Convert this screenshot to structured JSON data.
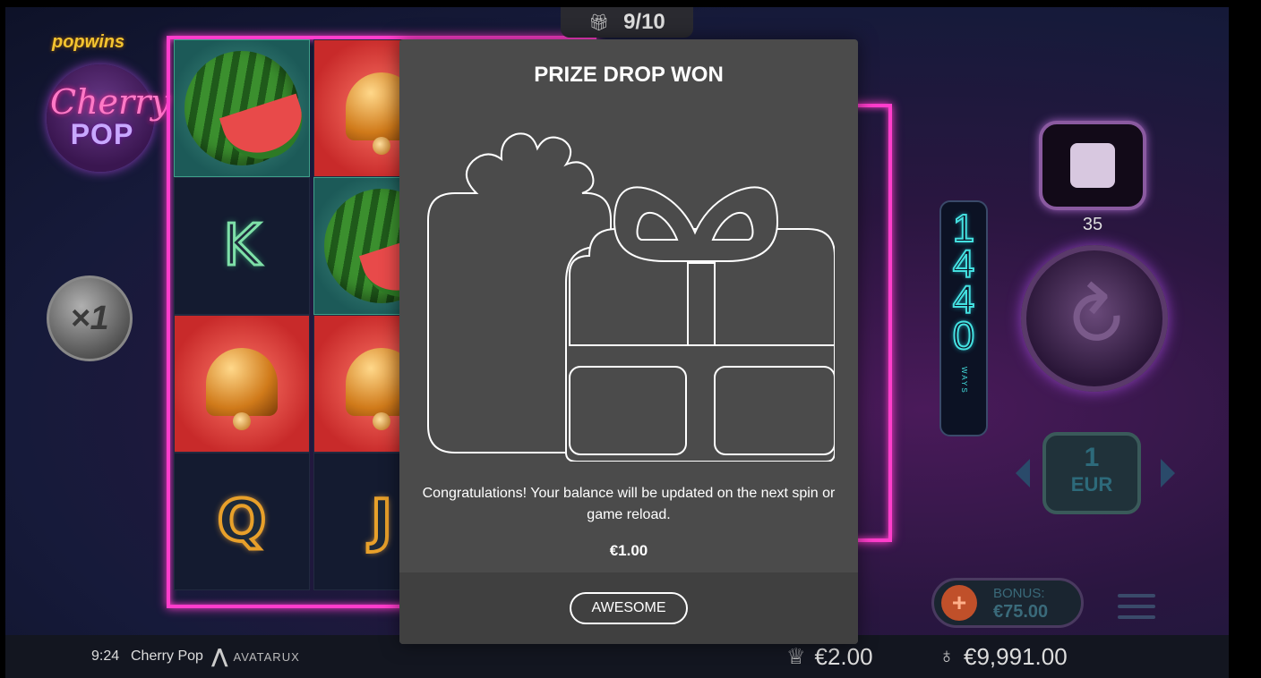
{
  "game": {
    "brand": "popwins",
    "logo_line1": "Cherry",
    "logo_line2": "POP",
    "multiplier": "×1",
    "ways_digits": [
      "1",
      "4",
      "4",
      "0"
    ],
    "ways_label": "WAYS",
    "free_spins_counter": "9/10",
    "autoplay_count": "35",
    "bet_value": "1",
    "bet_currency": "EUR",
    "bonus_label": "BONUS:",
    "bonus_amount": "€75.00",
    "reel_symbols": [
      [
        "watermelon",
        "K",
        "bell",
        "Q"
      ],
      [
        "bell",
        "watermelon",
        "bell",
        "J"
      ]
    ]
  },
  "modal": {
    "title": "PRIZE DROP WON",
    "message": "Congratulations! Your balance will be updated on the next spin or game reload.",
    "amount": "€1.00",
    "button_label": "AWESOME"
  },
  "status_bar": {
    "time": "9:24",
    "game_name": "Cherry Pop",
    "provider": "AVATARUX",
    "win": "€2.00",
    "balance": "€9,991.00"
  },
  "icons": {
    "gift": "gift-icon",
    "trophy": "trophy-icon",
    "moneybag": "moneybag-icon",
    "spin": "spin-arrow-icon",
    "stop": "stop-icon",
    "menu": "hamburger-menu-icon"
  },
  "colors": {
    "neon_pink": "#ff3dcc",
    "modal_bg": "#4b4b4b",
    "modal_footer": "#404040",
    "ways_cyan": "#44e0e0"
  }
}
